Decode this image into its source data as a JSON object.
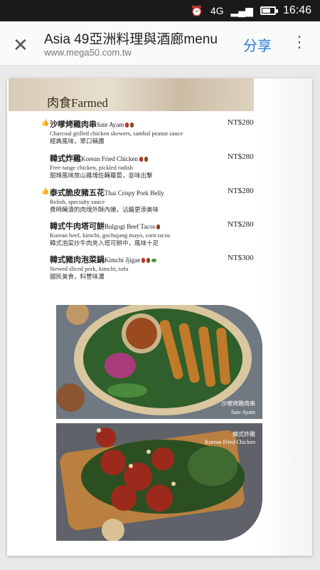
{
  "status": {
    "time": "16:46",
    "network": "4G"
  },
  "browser": {
    "title": "Asia 49亞洲料理與酒廊menu",
    "url": "www.mega50.com.tw",
    "share": "分享"
  },
  "menu": {
    "section": "肉食Farmed",
    "items": [
      {
        "name": "沙嗲烤雞肉串",
        "en": "Sate Ayam",
        "desc1": "Charcoal grilled chicken skewers, sambal peanut sauce",
        "desc2": "經典風味，眾口稱讚",
        "price": "NT$280"
      },
      {
        "name": "韓式炸雞",
        "en": "Korean Fried Chicken",
        "desc1": "Free range chicken, pickled radish",
        "desc2": "甜辣風味放山雞塊佐醃蘿蔔，韭味出擊",
        "price": "NT$280"
      },
      {
        "name": "泰式脆皮豬五花",
        "en": "Thai Crispy Pork Belly",
        "desc1": "Relish, specialty sauce",
        "desc2": "費時醃漬的肉塊外酥內嫩，沾醬更添美味",
        "price": "NT$280"
      },
      {
        "name": "韓式牛肉塔可餅",
        "en": "Bulgogi Beef Tacos",
        "desc1": "Korean beef, kimchi, gochujang mayo, corn tacos",
        "desc2": "韓式泡菜炒牛肉夾入塔可餅中，風味十足",
        "price": "NT$280"
      },
      {
        "name": "韓式豬肉泡菜鍋",
        "en": "Kimchi Jjigae",
        "desc1": "Stewed sliced pork, kimchi, tofu",
        "desc2": "國民美食，料豐味濃",
        "price": "NT$300"
      }
    ],
    "photo1_caption": "沙嗲烤雞肉串",
    "photo1_caption_en": "Sate Ayam",
    "photo2_caption": "韓式炸雞",
    "photo2_caption_en": "Korean Fried Chicken"
  }
}
